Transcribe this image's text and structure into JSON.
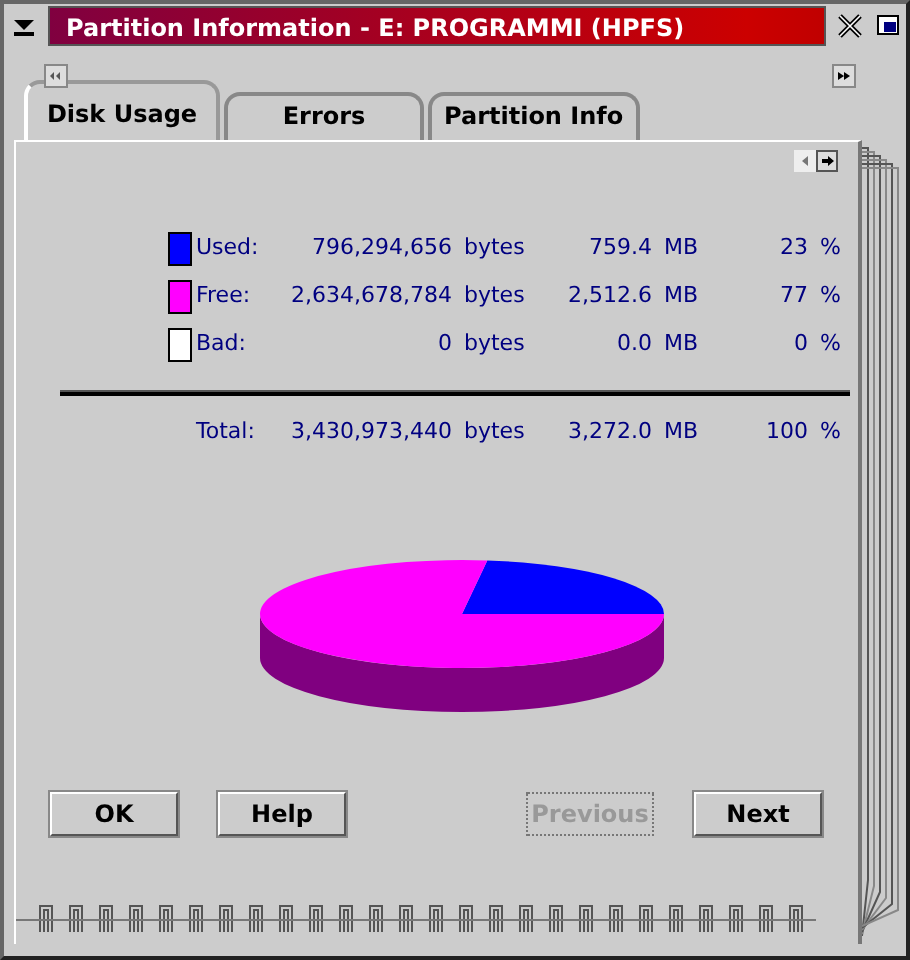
{
  "window": {
    "title": "Partition Information - E: PROGRAMMI (HPFS)"
  },
  "tabs": [
    {
      "label": "Disk Usage",
      "selected": true
    },
    {
      "label": "Errors",
      "selected": false
    },
    {
      "label": "Partition Info",
      "selected": false
    }
  ],
  "usage": {
    "rows": [
      {
        "label": "Used:",
        "color": "#0000ff",
        "bytes": "796,294,656",
        "bytes_unit": "bytes",
        "mb": "759.4",
        "mb_unit": "MB",
        "percent": "23",
        "percent_unit": "%"
      },
      {
        "label": "Free:",
        "color": "#ff00ff",
        "bytes": "2,634,678,784",
        "bytes_unit": "bytes",
        "mb": "2,512.6",
        "mb_unit": "MB",
        "percent": "77",
        "percent_unit": "%"
      },
      {
        "label": "Bad:",
        "color": "#ffffff",
        "bytes": "0",
        "bytes_unit": "bytes",
        "mb": "0.0",
        "mb_unit": "MB",
        "percent": "0",
        "percent_unit": "%"
      }
    ],
    "total": {
      "label": "Total:",
      "bytes": "3,430,973,440",
      "bytes_unit": "bytes",
      "mb": "3,272.0",
      "mb_unit": "MB",
      "percent": "100",
      "percent_unit": "%"
    }
  },
  "buttons": [
    {
      "label": "OK",
      "disabled": false
    },
    {
      "label": "Help",
      "disabled": false
    },
    {
      "label": "Previous",
      "disabled": true
    },
    {
      "label": "Next",
      "disabled": false
    }
  ]
}
